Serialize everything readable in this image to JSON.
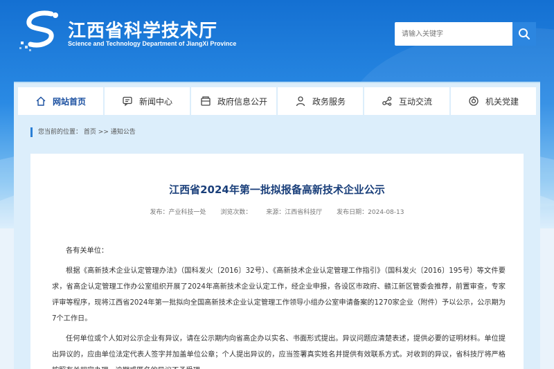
{
  "header": {
    "org_name_cn": "江西省科学技术厅",
    "org_name_en": "Science and Technology Department of JiangXi Province",
    "search_placeholder": "请输入关键字"
  },
  "nav": {
    "items": [
      {
        "label": "网站首页",
        "icon": "home-icon"
      },
      {
        "label": "新闻中心",
        "icon": "message-icon"
      },
      {
        "label": "政府信息公开",
        "icon": "folder-icon"
      },
      {
        "label": "政务服务",
        "icon": "person-icon"
      },
      {
        "label": "互动交流",
        "icon": "share-icon"
      },
      {
        "label": "机关党建",
        "icon": "emblem-icon"
      }
    ]
  },
  "breadcrumb": {
    "prefix": "您当前的位置：",
    "home": "首页",
    "sep": ">>",
    "current": "通知公告"
  },
  "article": {
    "title": "江西省2024年第一批拟报备高新技术企业公示",
    "meta_publisher": "发布：产业科技一处",
    "meta_views": "浏览次数：",
    "meta_source": "来源：江西省科技厅",
    "meta_date": "发布日期：2024-08-13",
    "salutation": "各有关单位：",
    "para1": "根据《高新技术企业认定管理办法》（国科发火〔2016〕32号）、《高新技术企业认定管理工作指引》（国科发火〔2016〕195号）等文件要求，省高企认定管理工作办公室组织开展了2024年高新技术企业认定工作，经企业申报，各设区市政府、赣江新区管委会推荐，前置审查，专家评审等程序，现将江西省2024年第一批拟向全国高新技术企业认定管理工作领导小组办公室申请备案的1270家企业（附件）予以公示，公示期为7个工作日。",
    "para2": "任何单位或个人如对公示企业有异议，请在公示期内向省高企办以实名、书面形式提出。异议问题应清楚表述，提供必要的证明材料。单位提出异议的，应由单位法定代表人签字并加盖单位公章；个人提出异议的，应当签署真实姓名并提供有效联系方式。对收到的异议，省科技厅将严格按照有关规定办理。逾期或匿名的异议不予受理。"
  },
  "colors": {
    "brand_blue": "#1470d2",
    "title_blue": "#1a3f7a",
    "accent": "#2a7fd6"
  }
}
